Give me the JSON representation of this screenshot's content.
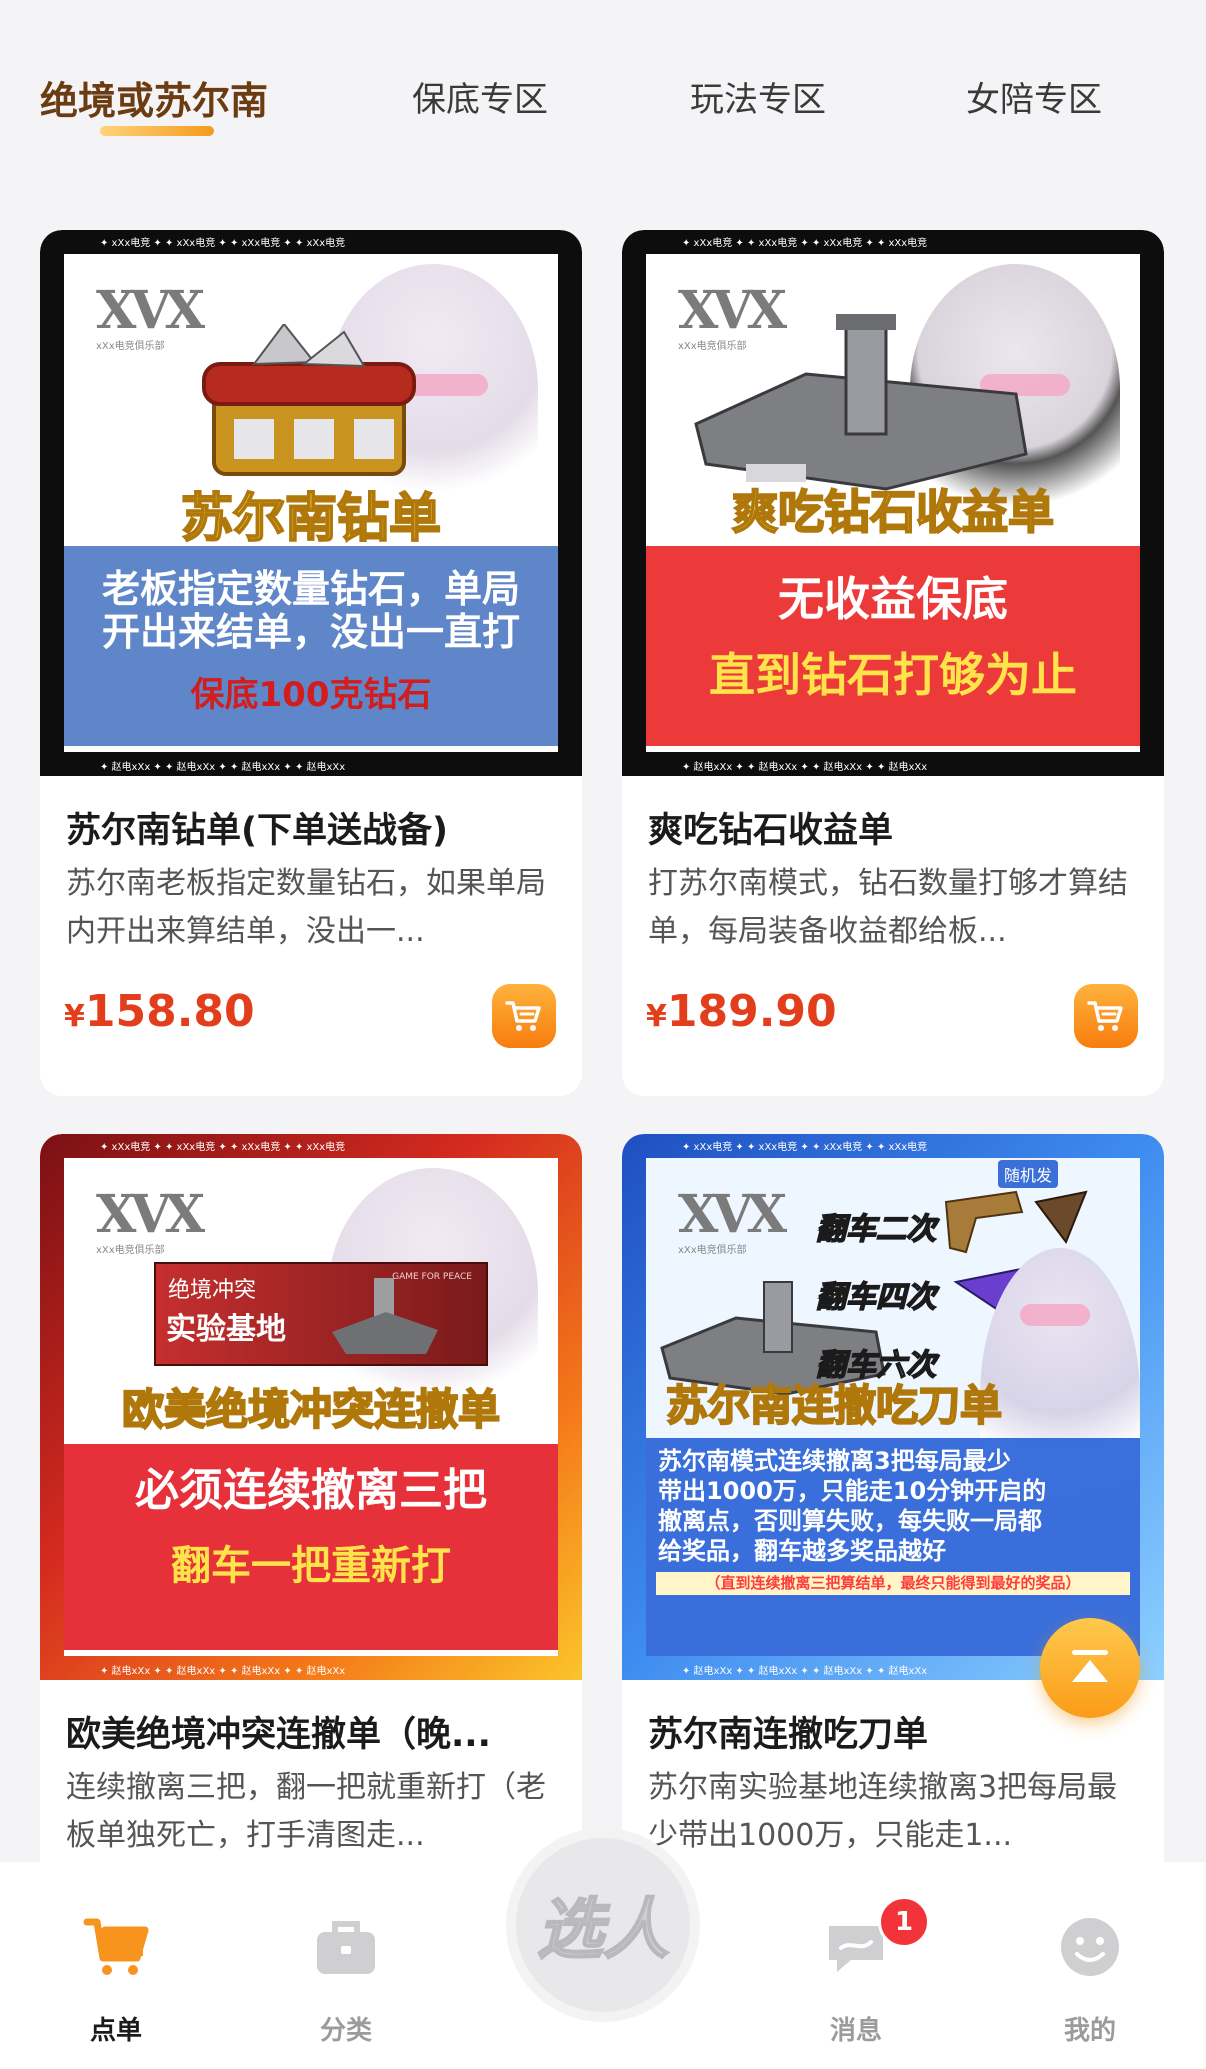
{
  "tabs": [
    "绝境或苏尔南",
    "保底专区",
    "玩法专区",
    "女陪专区"
  ],
  "cards": [
    {
      "cover": {
        "headline": "苏尔南钻单",
        "band_lines": [
          "老板指定数量钻石，单局",
          "开出来结单，没出一直打"
        ],
        "band_highlight": "保底100克钻石",
        "watermark": "xXx电竞",
        "logo_sub": "xXx电竞俱乐部",
        "band_color": "#5f86c8"
      },
      "title": "苏尔南钻单(下单送战备)",
      "desc": "苏尔南老板指定数量钻石，如果单局内开出来算结单，没出一...",
      "currency": "¥",
      "price": "158.80"
    },
    {
      "cover": {
        "headline": "爽吃钻石收益单",
        "band_lines": [
          "无收益保底"
        ],
        "band_highlight": "直到钻石打够为止",
        "watermark": "xXx电竞",
        "logo_sub": "xXx电竞俱乐部",
        "band_color": "#ec3a3a"
      },
      "title": "爽吃钻石收益单",
      "desc": "打苏尔南模式，钻石数量打够才算结单，每局装备收益都给板...",
      "currency": "¥",
      "price": "189.90"
    },
    {
      "cover": {
        "headline": "欧美绝境冲突连撤单",
        "band_lines": [
          "必须连续撤离三把"
        ],
        "band_highlight": "翻车一把重新打",
        "watermark": "xXx电竞",
        "logo_sub": "xXx电竞俱乐部",
        "inset_small": "绝境冲突",
        "inset_big": "实验基地",
        "inset_tag": "GAME FOR PEACE",
        "band_color": "#e6313a"
      },
      "title": "欧美绝境冲突连撤单（晚...",
      "desc": "连续撤离三把，翻一把就重新打（老板单独死亡，打手清图走..."
    },
    {
      "cover": {
        "headline": "苏尔南连撤吃刀单",
        "steps": [
          "翻车二次",
          "翻车四次",
          "翻车六次"
        ],
        "random_tag": "随机发",
        "band_lines": [
          "苏尔南模式连续撤离3把每局最少",
          "带出1000万，只能走10分钟开启的",
          "撤离点，否则算失败，每失败一局都",
          "给奖品，翻车越多奖品越好"
        ],
        "band_highlight": "（直到连续撤离三把算结单，最终只能得到最好的奖品）",
        "watermark": "xXx电竞",
        "logo_sub": "xXx电竞俱乐部",
        "band_color": "#2a63d8"
      },
      "title": "苏尔南连撤吃刀单",
      "desc": "苏尔南实验基地连续撤离3把每局最少带出1000万，只能走1..."
    }
  ],
  "nav": {
    "items": [
      "点单",
      "分类",
      "消息",
      "我的"
    ],
    "center": "选人",
    "badge": "1"
  },
  "colors": {
    "accent": "#f7941d",
    "price": "#e23e1c"
  }
}
